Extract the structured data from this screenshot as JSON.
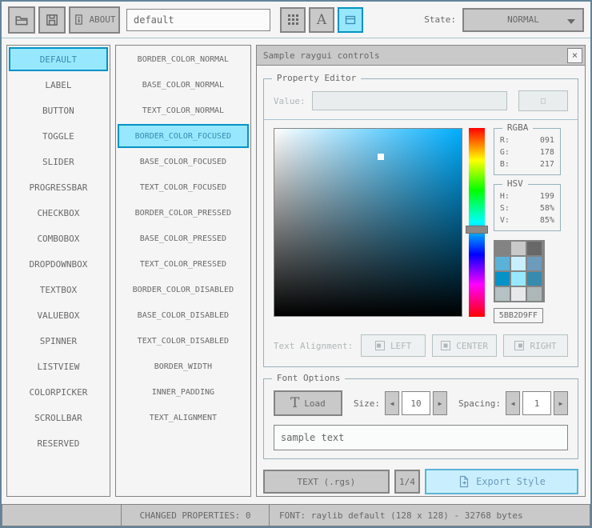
{
  "toolbar": {
    "about_label": "ABOUT",
    "style_name_value": "default",
    "state_label": "State:",
    "state_value": "NORMAL"
  },
  "controls_list": {
    "selected": "DEFAULT",
    "items": [
      "DEFAULT",
      "LABEL",
      "BUTTON",
      "TOGGLE",
      "SLIDER",
      "PROGRESSBAR",
      "CHECKBOX",
      "COMBOBOX",
      "DROPDOWNBOX",
      "TEXTBOX",
      "VALUEBOX",
      "SPINNER",
      "LISTVIEW",
      "COLORPICKER",
      "SCROLLBAR",
      "RESERVED"
    ]
  },
  "properties_list": {
    "selected": "BORDER_COLOR_FOCUSED",
    "items": [
      "BORDER_COLOR_NORMAL",
      "BASE_COLOR_NORMAL",
      "TEXT_COLOR_NORMAL",
      "BORDER_COLOR_FOCUSED",
      "BASE_COLOR_FOCUSED",
      "TEXT_COLOR_FOCUSED",
      "BORDER_COLOR_PRESSED",
      "BASE_COLOR_PRESSED",
      "TEXT_COLOR_PRESSED",
      "BORDER_COLOR_DISABLED",
      "BASE_COLOR_DISABLED",
      "TEXT_COLOR_DISABLED",
      "BORDER_WIDTH",
      "INNER_PADDING",
      "TEXT_ALIGNMENT"
    ]
  },
  "sample_window": {
    "title": "Sample raygui controls",
    "property_editor": {
      "group_label": "Property Editor",
      "value_label": "Value:",
      "value_text": "",
      "value_button_glyph": "□",
      "rgba": {
        "label": "RGBA",
        "r_label": "R:",
        "r": "091",
        "g_label": "G:",
        "g": "178",
        "b_label": "B:",
        "b": "217"
      },
      "hsv": {
        "label": "HSV",
        "h_label": "H:",
        "h": "199",
        "s_label": "S:",
        "s": "58%",
        "v_label": "V:",
        "v": "85%"
      },
      "swatches": [
        "#838383",
        "#c9c9c9",
        "#686868",
        "#5bb2d9",
        "#c9effe",
        "#6c9bbc",
        "#0492c7",
        "#97e8ff",
        "#368baf",
        "#b5c1c2",
        "#e6e9e9",
        "#aeb7b8"
      ],
      "hex_value": "5BB2D9FF",
      "text_alignment_label": "Text Alignment:",
      "align_left_label": "LEFT",
      "align_center_label": "CENTER",
      "align_right_label": "RIGHT"
    },
    "font_options": {
      "group_label": "Font Options",
      "load_icon_glyph": "T",
      "load_label": "Load",
      "size_label": "Size:",
      "size_value": "10",
      "spacing_label": "Spacing:",
      "spacing_value": "1",
      "sample_text": "sample text"
    },
    "footer": {
      "format_button_label": "TEXT (.rgs)",
      "format_count": "1/4",
      "export_button_label": "Export Style"
    }
  },
  "status_bar": {
    "changed_properties": "CHANGED PROPERTIES: 0",
    "font_info": "FONT: raylib default (128 x 128) - 32768 bytes"
  },
  "icons": {
    "close": "×",
    "font_atlas_letter": "A",
    "spin_left": "◀",
    "spin_right": "▶"
  },
  "colors": {
    "pressed_border": "#0492c7",
    "pressed_base": "#97e8ff",
    "pressed_text": "#368baf",
    "focused_border": "#5bb2d9",
    "focused_base": "#c9effe",
    "focused_text": "#6c9bbc",
    "normal_border": "#838383",
    "normal_base": "#c9c9c9",
    "normal_text": "#686868",
    "disabled_border": "#b5c1c2",
    "disabled_base": "#e6e9e9",
    "disabled_text": "#aeb7b8",
    "picker_hue": "#00aeff"
  }
}
